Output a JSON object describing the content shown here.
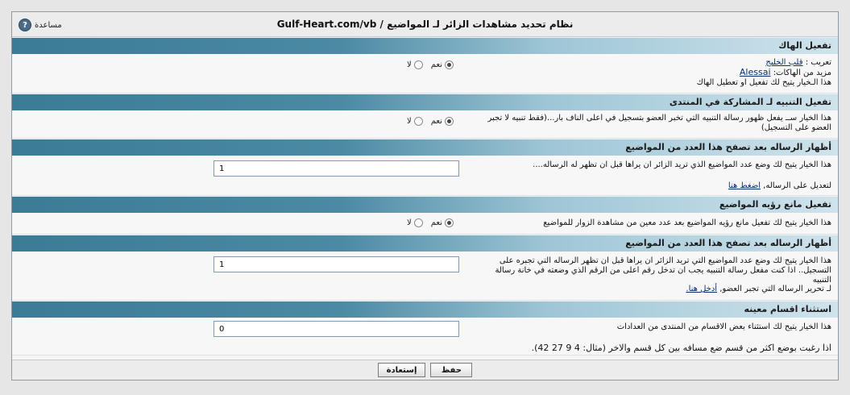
{
  "title": "نظام تحديد مشاهدات الزائر لـ المواضيع / Gulf-Heart.com/vb",
  "help_label": "مساعدة",
  "sections": [
    {
      "heading": "تفعيل الهاك",
      "credit_label": "تعريب :",
      "credit_link": "قلب الخليج",
      "more_label": "مزيد من الهاكات:",
      "more_link": "Alessai",
      "desc": "هذا الـخيار يتيح لك تفعيل او تعطيل الهاك",
      "yes": "نعم",
      "no": "لا"
    },
    {
      "heading": "تفعيل التنبيه لـ المشاركة في المنتدى",
      "desc": "هذا الخيار ســ يفعل ظهور رسالة التنبيه التي تخبر العضو بتسجيل في اعلى الناف بار...(فقط تنبيه لا تجبر العضو على التسجيل)",
      "yes": "نعم",
      "no": "لا"
    },
    {
      "heading": "أظهار الرساله بعد تصفح هذا العدد من المواضيع",
      "desc": "هذا الخيار يتيح لك وضع عدد المواضيع الذي تريد الزائر ان يراها قبل ان تظهر له الرساله....",
      "value": "1",
      "note_text": "لتعديل على الرساله,",
      "note_link": "اضغط هنا"
    },
    {
      "heading": "تفعيل مانع رؤيه المواضيع",
      "desc": "هذا الخيار يتيح لك تفعيل مانع رؤيه المواضيع بعد عدد معين من مشاهدة الزوار للمواضيع",
      "yes": "نعم",
      "no": "لا"
    },
    {
      "heading": "أظهار الرساله بعد تصفح هذا العدد من المواضيع",
      "desc": "هذا الخيار يتيح لك وضع عدد المواضيع التي تريد الزائر ان يراها قبل ان تظهر الرساله التي تجبره على التسجيل.. اذا كنت مفعل رسالة التنبيه يجب ان تدخل رقم اعلى من الرقم الذي وضعته في خانة رسالة التنبيه",
      "value": "1",
      "note_text": "لـ تحرير الرساله التي تجبر العضو,",
      "note_link": "أدخل هنا."
    },
    {
      "heading": "استثناء اقسام معينه",
      "desc": "هذا الخيار يتيح لك استثناء بعض الاقسام من المنتدى من العدادات",
      "value": "0",
      "note_text": "اذا رغبت بوضع اكثر من قسم ضع مسافه بين كل قسم والاخر (مثال: 4 9 27 42)."
    }
  ],
  "buttons": {
    "save": "حفظ",
    "reset": "إستعادة"
  }
}
